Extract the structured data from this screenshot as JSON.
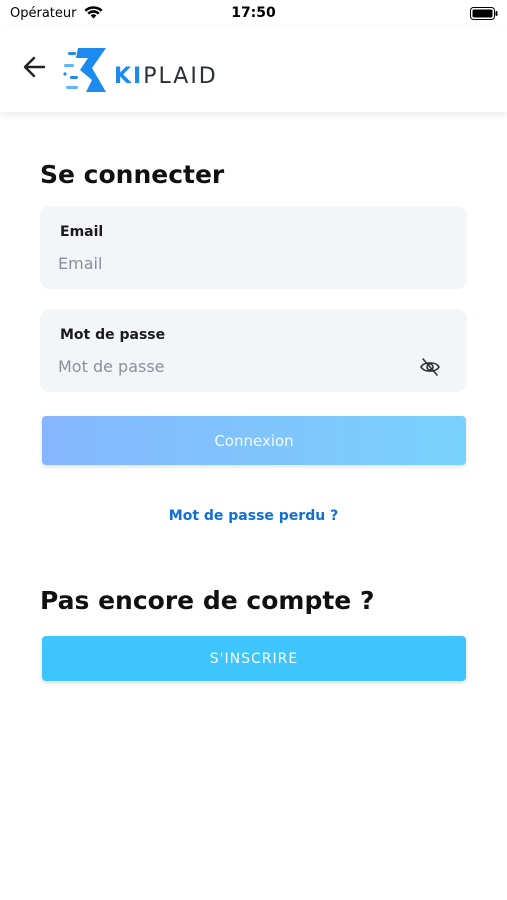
{
  "status_bar": {
    "carrier": "Opérateur",
    "time": "17:50"
  },
  "header": {
    "logo_text_accent": "KI",
    "logo_text_rest": "PLAID",
    "brand_color": "#1c8bf0"
  },
  "login": {
    "title": "Se connecter",
    "email_label": "Email",
    "email_placeholder": "Email",
    "email_value": "",
    "password_label": "Mot de passe",
    "password_placeholder": "Mot de passe",
    "password_value": "",
    "submit_label": "Connexion",
    "forgot_label": "Mot de passe perdu ?"
  },
  "signup": {
    "title": "Pas encore de compte ?",
    "button_label": "S'INSCRIRE"
  },
  "icons": {
    "back": "arrow-left-icon",
    "password_toggle": "eye-off-icon",
    "wifi": "wifi-icon",
    "battery": "battery-icon"
  }
}
